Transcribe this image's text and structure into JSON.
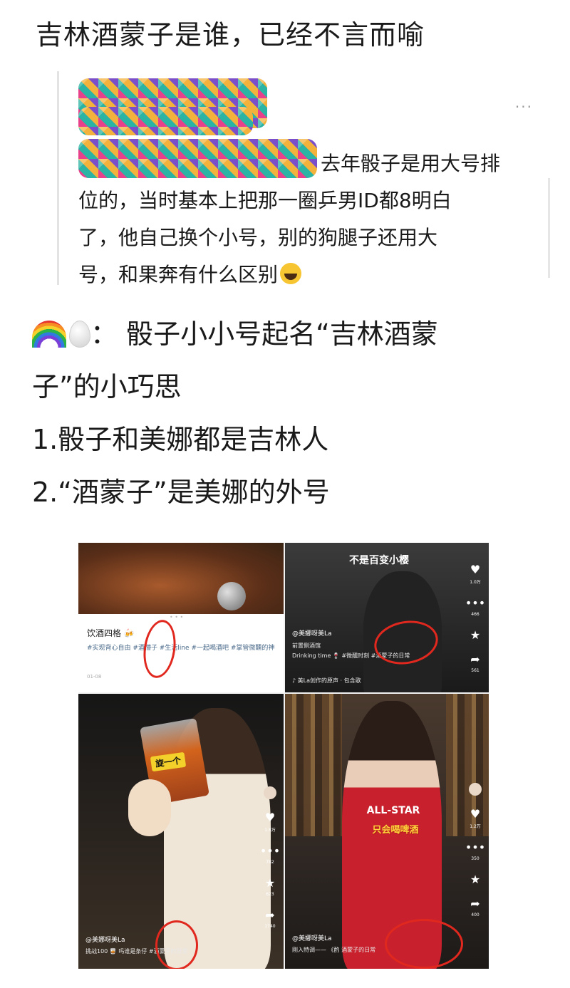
{
  "post": {
    "title": "吉林酒蒙子是谁，已经不言而喻",
    "quote": {
      "more_label": "···",
      "line1": "去年骰子是用大号排",
      "line2": "位的，当时基本上把那一圈乒男ID都8明白",
      "line3": "了，他自己换个小号，别的狗腿子还用大",
      "line4": "号，和果奔有什么区别",
      "emoji": "laughing-face"
    },
    "body": {
      "emojis": [
        "rainbow",
        "egg"
      ],
      "line1": "：  骰子小小号起名“吉林酒蒙",
      "line2": "子”的小巧思",
      "line3": "1.骰子和美娜都是吉林人",
      "line4": "2.“酒蒙子”是美娜的外号"
    }
  },
  "collage": {
    "panel1": {
      "dots": "• • •",
      "title": "饮酒四格 🍻",
      "tags": "#实现背心自由  #酒懵子  #生活line  #一起喝酒吧  #掌管微醺的神",
      "date": "01-08"
    },
    "panel2": {
      "overlay": "不是百变小樱",
      "author": "@美娜呀美La",
      "desc": "前置侧酒馆\nDrinking time 🍷 #微醺时刻 #酒蒙子的日常",
      "music": "♪ 美La创作的原声 · 包含歌",
      "rail_count1": "1.0万",
      "rail_count2": "466",
      "rail_count3": "561"
    },
    "panel3": {
      "sticker": "旋一个",
      "author": "@美娜呀美La",
      "desc": "挑战100 🥃 吗谁是条仔 #酒蒙子的日常",
      "rail_count1": "1.8万",
      "rail_count2": "782",
      "rail_count3": "623",
      "rail_count4": "1740"
    },
    "panel4": {
      "jersey": "ALL-STAR",
      "caption": "只会喝啤酒",
      "author": "@美娜呀美La",
      "desc": "刚入特调—— 《酌  酒蒙子的日常",
      "rail_count1": "1.2万",
      "rail_count2": "350",
      "rail_count3": "400"
    }
  },
  "colors": {
    "annotation_circle": "#e0281f",
    "text": "#1a1a1a",
    "tag_link": "#4a6a8a"
  }
}
